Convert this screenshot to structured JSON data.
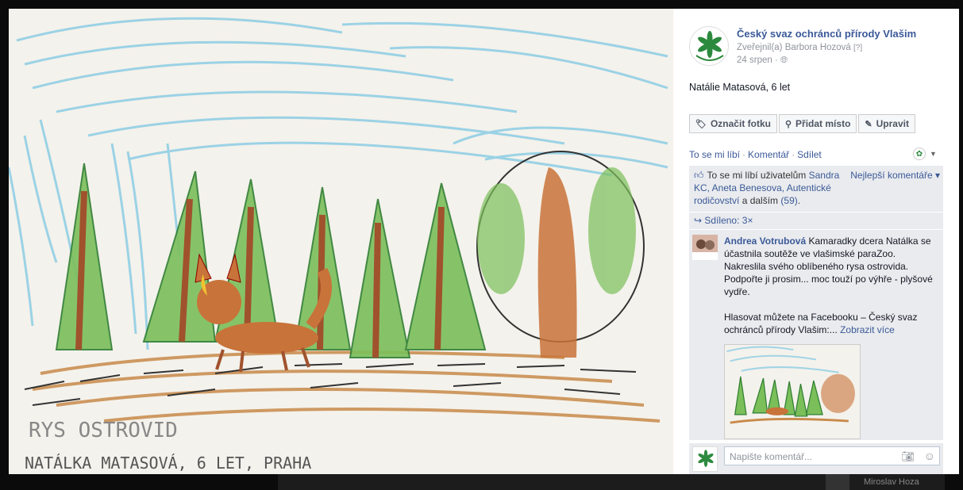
{
  "photo": {
    "title_text": "RYS OSTROVID",
    "caption_text": "NATÁLKA MATASOVÁ, 6 LET, PRAHA"
  },
  "close_label": "×",
  "header": {
    "page_name": "Český svaz ochránců přírody Vlašim",
    "posted_by": "Zveřejnil(a) Barbora Hozová",
    "help": "[?]",
    "date": "24 srpen",
    "privacy_icon": "globe-icon"
  },
  "caption": "Natálie Matasová, 6 let",
  "actions": {
    "tag": "Označit fotku",
    "place": "Přidat místo",
    "edit": "Upravit"
  },
  "links": {
    "like": "To se mi líbí",
    "comment": "Komentář",
    "share": "Sdílet",
    "sep": "·"
  },
  "likes": {
    "prefix": "To se mi líbí uživatelům",
    "names": "Sandra KC, Aneta Benesova, Autentické rodičovství",
    "and_more": "a dalším",
    "count": "(59)",
    "best_comments": "Nejlepší komentáře ▾"
  },
  "shares": {
    "text": "Sdíleno: 3×"
  },
  "comment": {
    "author": "Andrea Votrubová",
    "text1": "Kamaradky dcera Natálka se účastnila soutěže ve vlašimské paraZoo. Nakreslila svého oblíbeného rysa ostrovida. Podpořte ji prosim... moc touží po výhře - plyšové vydře.",
    "text2": "Hlasovat můžete na Facebooku – Český svaz ochránců přírody Vlašim:...",
    "more": "Zobrazit více"
  },
  "write": {
    "placeholder": "Napište komentář..."
  },
  "behind": {
    "name": "Miroslav Hoza"
  }
}
